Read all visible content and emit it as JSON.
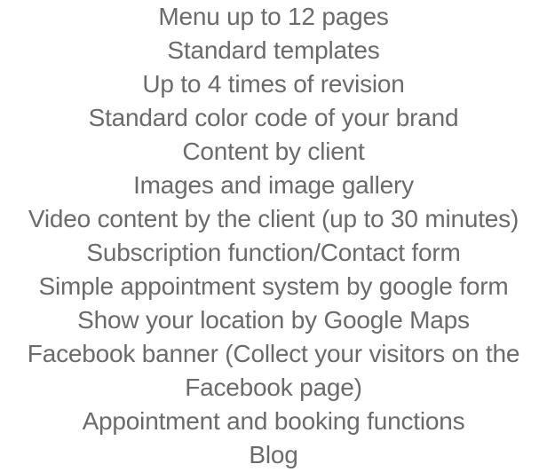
{
  "features": {
    "items": [
      "Menu up to 12 pages",
      "Standard templates",
      "Up to 4 times of revision",
      "Standard color code of your brand",
      "Content by client",
      "Images and image gallery",
      "Video content by the client (up to 30 minutes)",
      "Subscription function/Contact form",
      "Simple appointment system by google form",
      "Show your location by Google Maps",
      "Facebook banner (Collect your visitors on the",
      "Facebook page)",
      "Appointment and booking functions",
      "Blog"
    ]
  },
  "colors": {
    "text": "#6b6b6b",
    "background": "#ffffff"
  }
}
